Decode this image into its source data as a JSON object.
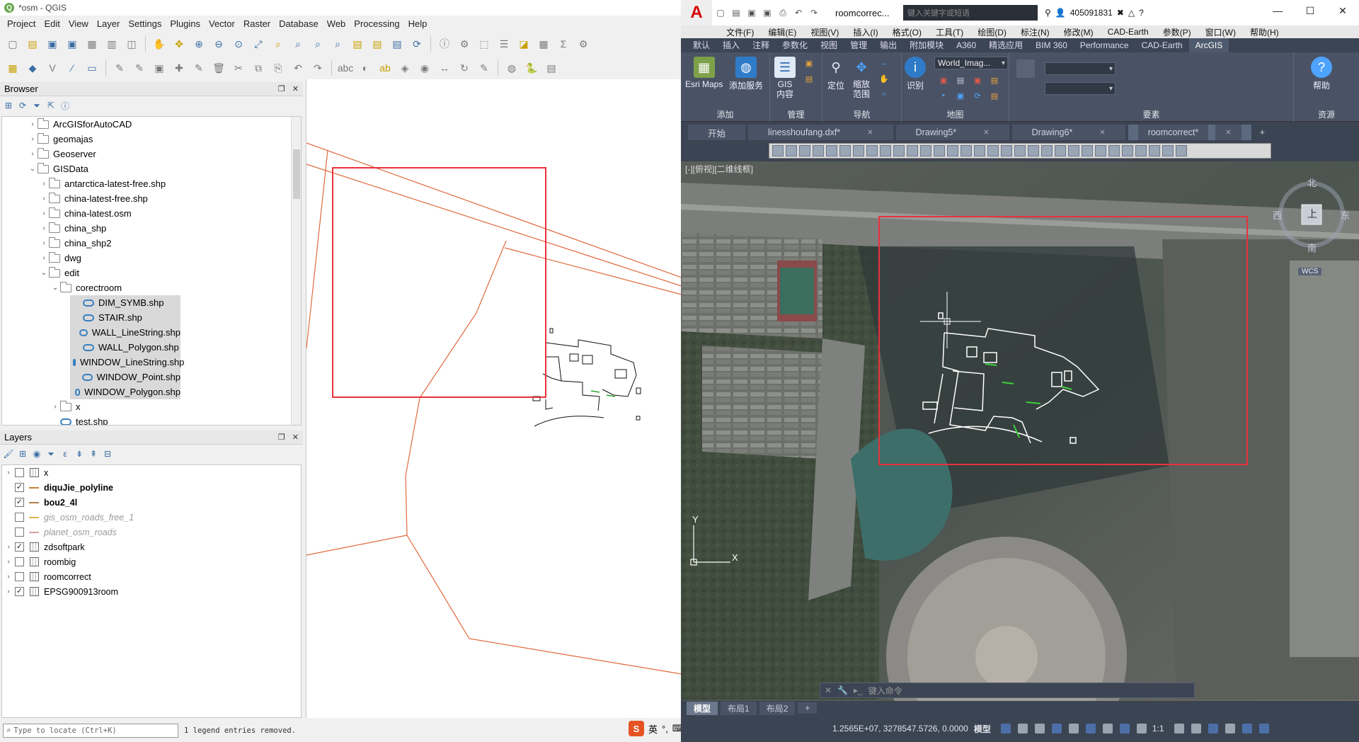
{
  "qgis": {
    "title": "*osm - QGIS",
    "menu": [
      "Project",
      "Edit",
      "View",
      "Layer",
      "Settings",
      "Plugins",
      "Vector",
      "Raster",
      "Database",
      "Web",
      "Processing",
      "Help"
    ],
    "browser": {
      "title": "Browser",
      "items": [
        {
          "label": "ArcGISforAutoCAD",
          "depth": 0,
          "arrow": "›",
          "kind": "folder"
        },
        {
          "label": "geomajas",
          "depth": 0,
          "arrow": "›",
          "kind": "folder"
        },
        {
          "label": "Geoserver",
          "depth": 0,
          "arrow": "›",
          "kind": "folder"
        },
        {
          "label": "GISData",
          "depth": 0,
          "arrow": "⌄",
          "kind": "folder"
        },
        {
          "label": "antarctica-latest-free.shp",
          "depth": 1,
          "arrow": "›",
          "kind": "folder"
        },
        {
          "label": "china-latest-free.shp",
          "depth": 1,
          "arrow": "›",
          "kind": "folder"
        },
        {
          "label": "china-latest.osm",
          "depth": 1,
          "arrow": "›",
          "kind": "folder"
        },
        {
          "label": "china_shp",
          "depth": 1,
          "arrow": "›",
          "kind": "folder"
        },
        {
          "label": "china_shp2",
          "depth": 1,
          "arrow": "›",
          "kind": "folder"
        },
        {
          "label": "dwg",
          "depth": 1,
          "arrow": "›",
          "kind": "folder"
        },
        {
          "label": "edit",
          "depth": 1,
          "arrow": "⌄",
          "kind": "folder"
        },
        {
          "label": "corectroom",
          "depth": 2,
          "arrow": "⌄",
          "kind": "folder"
        },
        {
          "label": "DIM_SYMB.shp",
          "depth": 3,
          "arrow": "",
          "kind": "shp",
          "selected": true
        },
        {
          "label": "STAIR.shp",
          "depth": 3,
          "arrow": "",
          "kind": "shp",
          "selected": true
        },
        {
          "label": "WALL_LineString.shp",
          "depth": 3,
          "arrow": "",
          "kind": "shp",
          "selected": true
        },
        {
          "label": "WALL_Polygon.shp",
          "depth": 3,
          "arrow": "",
          "kind": "shp",
          "selected": true
        },
        {
          "label": "WINDOW_LineString.shp",
          "depth": 3,
          "arrow": "",
          "kind": "shp",
          "selected": true
        },
        {
          "label": "WINDOW_Point.shp",
          "depth": 3,
          "arrow": "",
          "kind": "shp",
          "selected": true
        },
        {
          "label": "WINDOW_Polygon.shp",
          "depth": 3,
          "arrow": "",
          "kind": "shp",
          "selected": true
        },
        {
          "label": "x",
          "depth": 2,
          "arrow": "›",
          "kind": "folder"
        },
        {
          "label": "test.shp",
          "depth": 2,
          "arrow": "",
          "kind": "shp"
        }
      ]
    },
    "layers": {
      "title": "Layers",
      "items": [
        {
          "label": "x",
          "checked": false,
          "arrow": "›",
          "sym": "grid",
          "style": ""
        },
        {
          "label": "diquJie_polyline",
          "checked": true,
          "arrow": "",
          "sym": "line",
          "color": "#c87d3c",
          "style": "bold"
        },
        {
          "label": "bou2_4l",
          "checked": true,
          "arrow": "",
          "sym": "line",
          "color": "#b07a4c",
          "style": "bold"
        },
        {
          "label": "gis_osm_roads_free_1",
          "checked": false,
          "arrow": "",
          "sym": "line",
          "color": "#e3b24a",
          "style": "dim"
        },
        {
          "label": "planet_osm_roads",
          "checked": false,
          "arrow": "",
          "sym": "line",
          "color": "#d9a0a0",
          "style": "dim"
        },
        {
          "label": "zdsoftpark",
          "checked": true,
          "arrow": "›",
          "sym": "grid",
          "style": ""
        },
        {
          "label": "roombig",
          "checked": false,
          "arrow": "›",
          "sym": "grid",
          "style": ""
        },
        {
          "label": "roomcorrect",
          "checked": false,
          "arrow": "›",
          "sym": "grid",
          "style": ""
        },
        {
          "label": "EPSG900913room",
          "checked": true,
          "arrow": "›",
          "sym": "grid",
          "style": ""
        }
      ]
    },
    "locate_placeholder": "Type to locate (Ctrl+K)",
    "status_message": "1 legend entries removed.",
    "ime_label": "英"
  },
  "cad": {
    "doc_title": "roomcorrec...",
    "search_placeholder": "键入关键字或短语",
    "user_id": "405091831",
    "menu": [
      "文件(F)",
      "编辑(E)",
      "视图(V)",
      "插入(I)",
      "格式(O)",
      "工具(T)",
      "绘图(D)",
      "标注(N)",
      "修改(M)",
      "CAD-Earth",
      "参数(P)",
      "窗口(W)",
      "帮助(H)"
    ],
    "ribbon_tabs": [
      "默认",
      "插入",
      "注释",
      "参数化",
      "视图",
      "管理",
      "输出",
      "附加模块",
      "A360",
      "精选应用",
      "BIM 360",
      "Performance",
      "CAD-Earth",
      "ArcGIS"
    ],
    "ribbon_active": "ArcGIS",
    "ribbon": {
      "esri_maps": "Esri Maps",
      "add_service": "添加服务",
      "group_add": "添加",
      "gis_content": "GIS\n内容",
      "group_manage": "管理",
      "locate": "定位",
      "zoom_extent": "缩放\n范围",
      "group_nav": "导航",
      "identify": "识别",
      "basemap": "World_Imag...",
      "group_map": "地图",
      "group_features": "要素",
      "help": "帮助",
      "group_resources": "资源"
    },
    "doc_tabs": [
      {
        "label": "开始",
        "active": false,
        "closable": false
      },
      {
        "label": "linesshoufang.dxf*",
        "active": false,
        "closable": true
      },
      {
        "label": "Drawing5*",
        "active": false,
        "closable": true
      },
      {
        "label": "Drawing6*",
        "active": false,
        "closable": true
      },
      {
        "label": "roomcorrect*",
        "active": true,
        "closable": true
      }
    ],
    "viewport_label": "[-][俯视][二维线框]",
    "viewcube": {
      "north": "北",
      "south": "南",
      "east": "东",
      "west": "西",
      "face": "上",
      "wcs": "WCS"
    },
    "cmd_placeholder": "键入命令",
    "layout_tabs": [
      {
        "label": "模型",
        "active": true
      },
      {
        "label": "布局1",
        "active": false
      },
      {
        "label": "布局2",
        "active": false
      }
    ],
    "coords": "1.2565E+07, 3278547.5726, 0.0000",
    "space": "模型",
    "scale": "1:1"
  },
  "colors": {
    "highlight_box": "#e8323c",
    "osm_line": "#e06a3c",
    "cad_dark": "#3b4453"
  }
}
